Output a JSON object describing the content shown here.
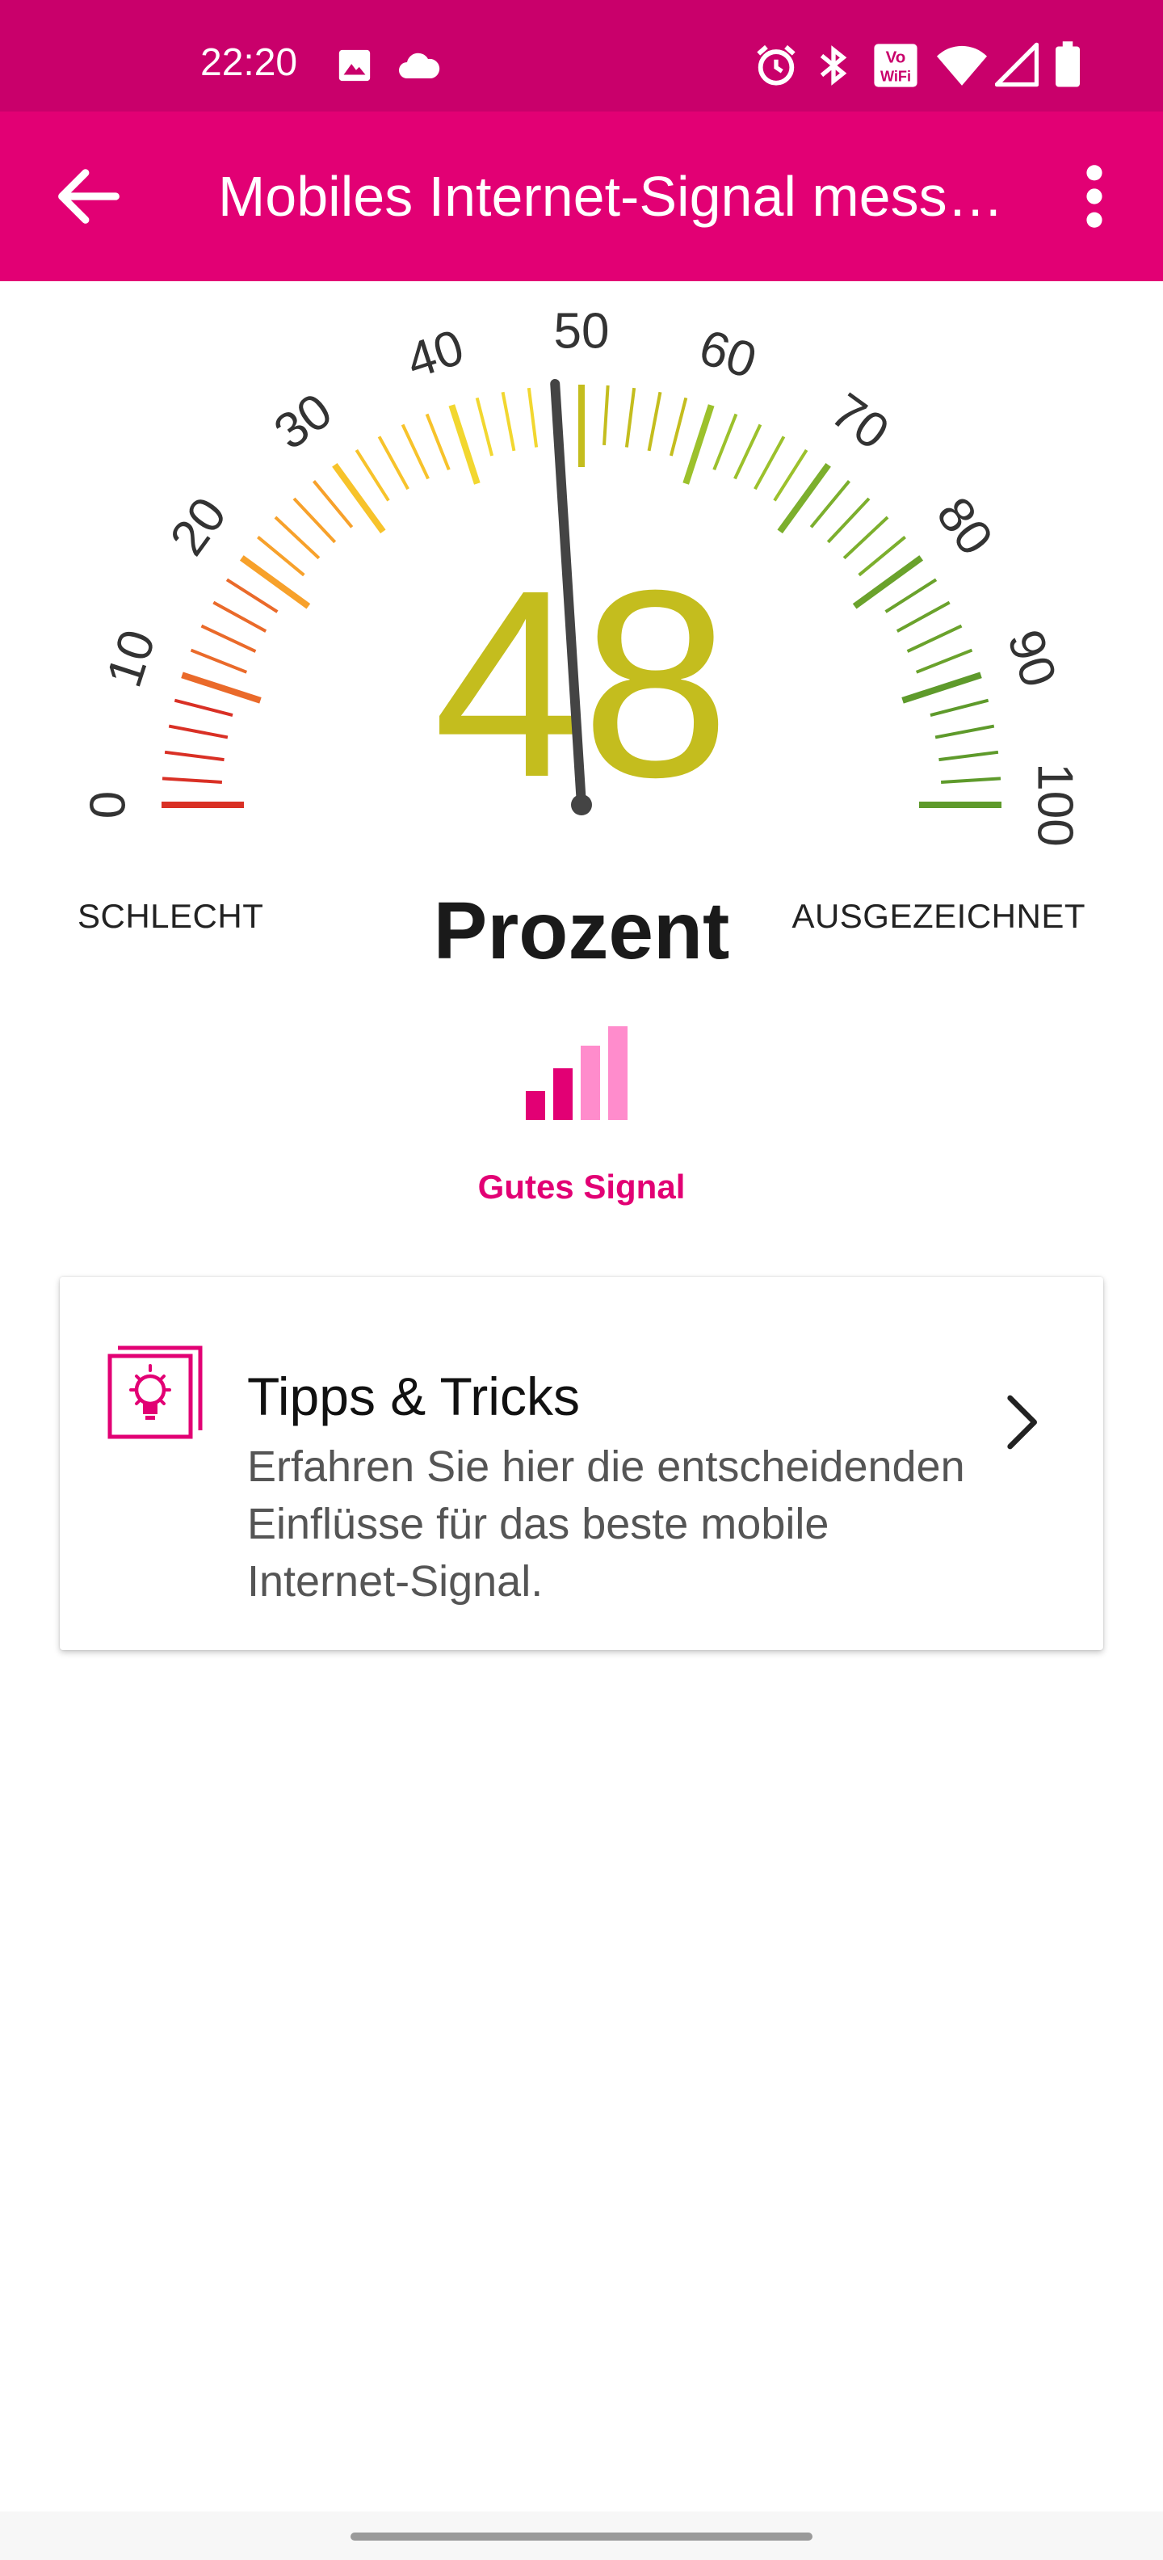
{
  "status_bar": {
    "time": "22:20",
    "left_icons": [
      "image-icon",
      "cloud-icon"
    ],
    "right_icons": [
      "alarm-icon",
      "bluetooth-icon",
      "vowifi-icon",
      "wifi-icon",
      "cell-signal-icon",
      "battery-icon"
    ],
    "vowifi_text_top": "Vo",
    "vowifi_text_bottom": "WiFi"
  },
  "app_bar": {
    "title": "Mobiles Internet-Signal messen",
    "back_icon": "arrow-left-icon",
    "menu_icon": "more-vertical-icon"
  },
  "gauge": {
    "value": 48,
    "value_text": "48",
    "unit": "Prozent",
    "min": 0,
    "max": 100,
    "tick_labels": [
      "0",
      "10",
      "20",
      "30",
      "40",
      "50",
      "60",
      "70",
      "80",
      "90",
      "100"
    ],
    "low_label": "SCHLECHT",
    "high_label": "AUSGEZEICHNET",
    "value_color": "#c4bd1e",
    "scale_colors": [
      "#d93025",
      "#ea6a2a",
      "#f7a12b",
      "#f7c32b",
      "#f2d730",
      "#c4bd1e",
      "#9cc12c",
      "#7caf2d",
      "#6aa22c",
      "#5e9a2b"
    ]
  },
  "signal": {
    "label": "Gutes Signal",
    "bars_total": 4,
    "bars_active": 2,
    "active_color": "#e20074",
    "inactive_color": "#ff8ccc"
  },
  "tips_card": {
    "title": "Tipps & Tricks",
    "description": "Erfahren Sie hier die entscheidenden Einflüsse für das beste mobile Internet-Signal.",
    "icon": "lightbulb-icon",
    "chevron_icon": "chevron-right-icon"
  },
  "colors": {
    "status_bar": "#c9006b",
    "app_bar": "#e20074",
    "accent": "#e20074"
  }
}
